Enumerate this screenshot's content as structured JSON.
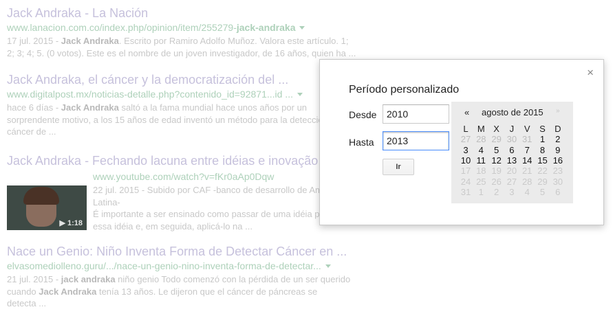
{
  "results": [
    {
      "title": "Jack Andraka - La Nación",
      "url_pre": "www.lanacion.com.co/index.php/opinion/item/255279-",
      "url_bold": "jack-andraka",
      "snippet_date": "17 jul. 2015 - ",
      "snippet_bold": "Jack Andraka",
      "snippet_l1": ". Escrito por Ramiro Adolfo Muñoz. Valora este artículo. 1;",
      "snippet_l2": "2; 3; 4; 5. (0 votos). Este es el nombre de un joven investigador, de 16 años, quien ha ..."
    },
    {
      "title": "Jack Andraka, el cáncer y la democratización del ...",
      "url": "www.digitalpost.mx/noticias-detalle.php?contenido_id=92871...id ...",
      "snippet_date": "hace 6 días - ",
      "snippet_bold": "Jack Andraka",
      "snippet_l1": " saltó a la fama mundial hace unos años por un",
      "snippet_l2": "sorprendente motivo, a los 15 años de edad inventó un método para la detecció",
      "snippet_l3": "cáncer de ..."
    },
    {
      "title": "Jack Andraka - Fechando lacuna entre idéias e inovação",
      "url": "www.youtube.com/watch?v=fKr0aAp0Dqw",
      "snippet_l1": "22 jul. 2015 - Subido por CAF -banco de desarrollo de Am",
      "snippet_l2": "Latina-",
      "snippet_l3": "É importante a ser ensinado como passar de uma idéia p",
      "snippet_l4": "essa idéia e, em seguida, aplicá-lo na ...",
      "duration": "1:18"
    },
    {
      "title": "Nace un Genio: Niño Inventa Forma de Detectar Cáncer en ...",
      "url": "elvasomediolleno.guru/.../nace-un-genio-nino-inventa-forma-de-detectar...",
      "snippet_date": "21 jul. 2015 - ",
      "snippet_bold": "jack andraka",
      "snippet_l1": " niño genio Todo comenzó con la pérdida de un ser querido",
      "snippet_l2_pre": "cuando ",
      "snippet_l2_bold": "Jack Andraka",
      "snippet_l2_post": " tenía 13 años. Le dijeron que el cáncer de páncreas se",
      "snippet_l3": "detecta ..."
    }
  ],
  "dialog": {
    "title": "Período personalizado",
    "close": "×",
    "from_label": "Desde",
    "from_value": "2010",
    "to_label": "Hasta",
    "to_value": "2013",
    "go_label": "Ir"
  },
  "calendar": {
    "prev": "«",
    "month": "agosto de 2015",
    "next": "»",
    "weekdays": [
      "L",
      "M",
      "X",
      "J",
      "V",
      "S",
      "D"
    ],
    "weeks": [
      [
        {
          "d": "27",
          "s": "dim"
        },
        {
          "d": "28",
          "s": "dim"
        },
        {
          "d": "29",
          "s": "dim"
        },
        {
          "d": "30",
          "s": "dim"
        },
        {
          "d": "31",
          "s": "dim"
        },
        {
          "d": "1",
          "s": "cur"
        },
        {
          "d": "2",
          "s": "cur"
        }
      ],
      [
        {
          "d": "3",
          "s": "cur"
        },
        {
          "d": "4",
          "s": "cur"
        },
        {
          "d": "5",
          "s": "cur"
        },
        {
          "d": "6",
          "s": "cur"
        },
        {
          "d": "7",
          "s": "cur"
        },
        {
          "d": "8",
          "s": "cur"
        },
        {
          "d": "9",
          "s": "cur"
        }
      ],
      [
        {
          "d": "10",
          "s": "cur"
        },
        {
          "d": "11",
          "s": "cur"
        },
        {
          "d": "12",
          "s": "cur"
        },
        {
          "d": "13",
          "s": "cur"
        },
        {
          "d": "14",
          "s": "cur"
        },
        {
          "d": "15",
          "s": "cur"
        },
        {
          "d": "16",
          "s": "cur"
        }
      ],
      [
        {
          "d": "17",
          "s": "na"
        },
        {
          "d": "18",
          "s": "na"
        },
        {
          "d": "19",
          "s": "na"
        },
        {
          "d": "20",
          "s": "na"
        },
        {
          "d": "21",
          "s": "na"
        },
        {
          "d": "22",
          "s": "na"
        },
        {
          "d": "23",
          "s": "na"
        }
      ],
      [
        {
          "d": "24",
          "s": "na"
        },
        {
          "d": "25",
          "s": "na"
        },
        {
          "d": "26",
          "s": "na"
        },
        {
          "d": "27",
          "s": "na"
        },
        {
          "d": "28",
          "s": "na"
        },
        {
          "d": "29",
          "s": "na"
        },
        {
          "d": "30",
          "s": "na"
        }
      ],
      [
        {
          "d": "31",
          "s": "na"
        },
        {
          "d": "1",
          "s": "na"
        },
        {
          "d": "2",
          "s": "na"
        },
        {
          "d": "3",
          "s": "na"
        },
        {
          "d": "4",
          "s": "na"
        },
        {
          "d": "5",
          "s": "na"
        },
        {
          "d": "6",
          "s": "na"
        }
      ]
    ]
  },
  "colors": {
    "title_visited": "#c6c1dc",
    "url_green": "#aed1ba",
    "snippet_gray": "#c8c8c8",
    "focus_blue": "#4d90fe",
    "calendar_bg": "#ebebeb"
  }
}
